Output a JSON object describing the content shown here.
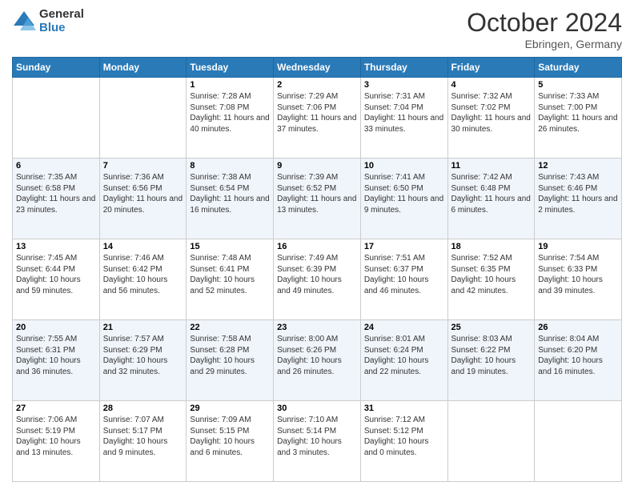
{
  "header": {
    "logo_general": "General",
    "logo_blue": "Blue",
    "month": "October 2024",
    "location": "Ebringen, Germany"
  },
  "days_of_week": [
    "Sunday",
    "Monday",
    "Tuesday",
    "Wednesday",
    "Thursday",
    "Friday",
    "Saturday"
  ],
  "weeks": [
    [
      {
        "day": "",
        "info": ""
      },
      {
        "day": "",
        "info": ""
      },
      {
        "day": "1",
        "info": "Sunrise: 7:28 AM\nSunset: 7:08 PM\nDaylight: 11 hours and 40 minutes."
      },
      {
        "day": "2",
        "info": "Sunrise: 7:29 AM\nSunset: 7:06 PM\nDaylight: 11 hours and 37 minutes."
      },
      {
        "day": "3",
        "info": "Sunrise: 7:31 AM\nSunset: 7:04 PM\nDaylight: 11 hours and 33 minutes."
      },
      {
        "day": "4",
        "info": "Sunrise: 7:32 AM\nSunset: 7:02 PM\nDaylight: 11 hours and 30 minutes."
      },
      {
        "day": "5",
        "info": "Sunrise: 7:33 AM\nSunset: 7:00 PM\nDaylight: 11 hours and 26 minutes."
      }
    ],
    [
      {
        "day": "6",
        "info": "Sunrise: 7:35 AM\nSunset: 6:58 PM\nDaylight: 11 hours and 23 minutes."
      },
      {
        "day": "7",
        "info": "Sunrise: 7:36 AM\nSunset: 6:56 PM\nDaylight: 11 hours and 20 minutes."
      },
      {
        "day": "8",
        "info": "Sunrise: 7:38 AM\nSunset: 6:54 PM\nDaylight: 11 hours and 16 minutes."
      },
      {
        "day": "9",
        "info": "Sunrise: 7:39 AM\nSunset: 6:52 PM\nDaylight: 11 hours and 13 minutes."
      },
      {
        "day": "10",
        "info": "Sunrise: 7:41 AM\nSunset: 6:50 PM\nDaylight: 11 hours and 9 minutes."
      },
      {
        "day": "11",
        "info": "Sunrise: 7:42 AM\nSunset: 6:48 PM\nDaylight: 11 hours and 6 minutes."
      },
      {
        "day": "12",
        "info": "Sunrise: 7:43 AM\nSunset: 6:46 PM\nDaylight: 11 hours and 2 minutes."
      }
    ],
    [
      {
        "day": "13",
        "info": "Sunrise: 7:45 AM\nSunset: 6:44 PM\nDaylight: 10 hours and 59 minutes."
      },
      {
        "day": "14",
        "info": "Sunrise: 7:46 AM\nSunset: 6:42 PM\nDaylight: 10 hours and 56 minutes."
      },
      {
        "day": "15",
        "info": "Sunrise: 7:48 AM\nSunset: 6:41 PM\nDaylight: 10 hours and 52 minutes."
      },
      {
        "day": "16",
        "info": "Sunrise: 7:49 AM\nSunset: 6:39 PM\nDaylight: 10 hours and 49 minutes."
      },
      {
        "day": "17",
        "info": "Sunrise: 7:51 AM\nSunset: 6:37 PM\nDaylight: 10 hours and 46 minutes."
      },
      {
        "day": "18",
        "info": "Sunrise: 7:52 AM\nSunset: 6:35 PM\nDaylight: 10 hours and 42 minutes."
      },
      {
        "day": "19",
        "info": "Sunrise: 7:54 AM\nSunset: 6:33 PM\nDaylight: 10 hours and 39 minutes."
      }
    ],
    [
      {
        "day": "20",
        "info": "Sunrise: 7:55 AM\nSunset: 6:31 PM\nDaylight: 10 hours and 36 minutes."
      },
      {
        "day": "21",
        "info": "Sunrise: 7:57 AM\nSunset: 6:29 PM\nDaylight: 10 hours and 32 minutes."
      },
      {
        "day": "22",
        "info": "Sunrise: 7:58 AM\nSunset: 6:28 PM\nDaylight: 10 hours and 29 minutes."
      },
      {
        "day": "23",
        "info": "Sunrise: 8:00 AM\nSunset: 6:26 PM\nDaylight: 10 hours and 26 minutes."
      },
      {
        "day": "24",
        "info": "Sunrise: 8:01 AM\nSunset: 6:24 PM\nDaylight: 10 hours and 22 minutes."
      },
      {
        "day": "25",
        "info": "Sunrise: 8:03 AM\nSunset: 6:22 PM\nDaylight: 10 hours and 19 minutes."
      },
      {
        "day": "26",
        "info": "Sunrise: 8:04 AM\nSunset: 6:20 PM\nDaylight: 10 hours and 16 minutes."
      }
    ],
    [
      {
        "day": "27",
        "info": "Sunrise: 7:06 AM\nSunset: 5:19 PM\nDaylight: 10 hours and 13 minutes."
      },
      {
        "day": "28",
        "info": "Sunrise: 7:07 AM\nSunset: 5:17 PM\nDaylight: 10 hours and 9 minutes."
      },
      {
        "day": "29",
        "info": "Sunrise: 7:09 AM\nSunset: 5:15 PM\nDaylight: 10 hours and 6 minutes."
      },
      {
        "day": "30",
        "info": "Sunrise: 7:10 AM\nSunset: 5:14 PM\nDaylight: 10 hours and 3 minutes."
      },
      {
        "day": "31",
        "info": "Sunrise: 7:12 AM\nSunset: 5:12 PM\nDaylight: 10 hours and 0 minutes."
      },
      {
        "day": "",
        "info": ""
      },
      {
        "day": "",
        "info": ""
      }
    ]
  ]
}
